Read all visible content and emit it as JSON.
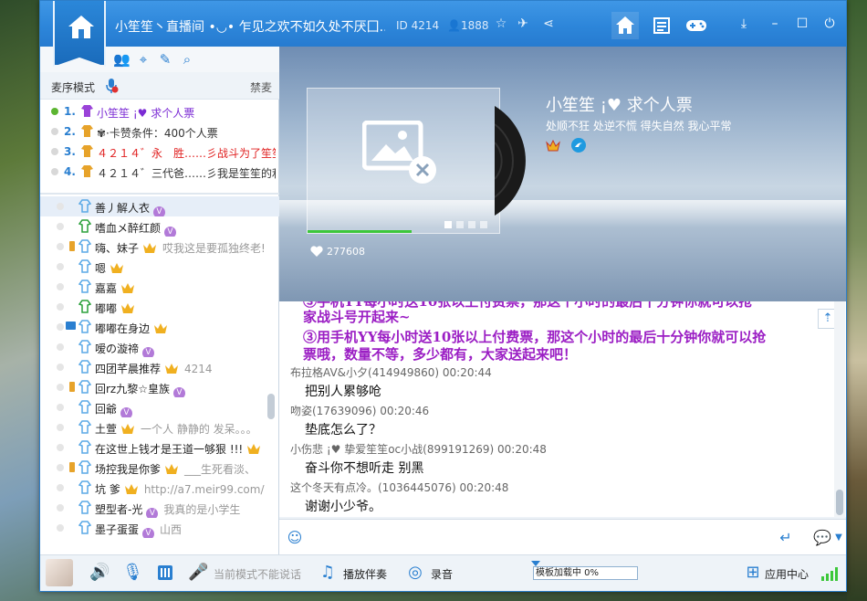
{
  "window": {
    "title": "小笙笙丶直播间 •◡• 乍见之欢不如久处不厌囗...",
    "id_label": "ID 4214",
    "user_count": "1888"
  },
  "left": {
    "mode_label": "麦序模式",
    "ban_label": "禁麦",
    "queue": [
      {
        "num": "1.",
        "text": "小笙笙 ¡♥ 求个人票",
        "color": "purple",
        "active": true
      },
      {
        "num": "2.",
        "text": "✾·卡赞条件：400个人票",
        "color": "dark",
        "active": false
      },
      {
        "num": "3.",
        "text": "４２１４゛永　胜……彡战斗为了笙笙々",
        "color": "red",
        "active": false
      },
      {
        "num": "4.",
        "text": "４２１４゛三代爸……彡我是笙笙的利刃",
        "color": "dark",
        "active": false
      }
    ],
    "members": [
      {
        "name": "善丿解人衣",
        "extra": "",
        "device": "",
        "badge": "v",
        "sel": true
      },
      {
        "name": "嗜血メ醉红颜",
        "extra": "",
        "device": "",
        "badge": "v",
        "sel": false
      },
      {
        "name": "嗨、妹子",
        "extra": "哎我这是要孤独终老!",
        "device": "phone",
        "badge": "crown",
        "sel": false
      },
      {
        "name": "嗯",
        "extra": "",
        "device": "",
        "badge": "crown",
        "sel": false
      },
      {
        "name": "嘉嘉",
        "extra": "",
        "device": "",
        "badge": "crown",
        "sel": false
      },
      {
        "name": "嘟嘟",
        "extra": "",
        "device": "",
        "badge": "crown",
        "sel": false
      },
      {
        "name": "嘟嘟在身边",
        "extra": "",
        "device": "pc",
        "badge": "crown",
        "sel": false
      },
      {
        "name": "嗳の漩禘",
        "extra": "",
        "device": "",
        "badge": "v",
        "sel": false
      },
      {
        "name": "四团芊晨推荐",
        "extra": "4214",
        "device": "",
        "badge": "crown",
        "sel": false
      },
      {
        "name": "回rz九黎☆皇族",
        "extra": "",
        "device": "phone",
        "badge": "v",
        "sel": false
      },
      {
        "name": "回爺",
        "extra": "",
        "device": "",
        "badge": "v",
        "sel": false
      },
      {
        "name": "土萱",
        "extra": "一个人 静静的 发呆。。。",
        "device": "",
        "badge": "crown",
        "sel": false
      },
      {
        "name": "在这世上钱才是王道一够狠 !!!",
        "extra": "",
        "device": "",
        "badge": "crown",
        "sel": false
      },
      {
        "name": "场控我是你爹",
        "extra": "___生死看淡、",
        "device": "phone",
        "badge": "crown",
        "sel": false
      },
      {
        "name": "坑  爹",
        "extra": "http://a7.meir99.com/",
        "device": "",
        "badge": "crown",
        "sel": false
      },
      {
        "name": "塑型者-光",
        "extra": "我真的是小学生",
        "device": "",
        "badge": "v",
        "sel": false
      },
      {
        "name": "墨子蛋蛋",
        "extra": "山西",
        "device": "",
        "badge": "v",
        "sel": false
      }
    ]
  },
  "stage": {
    "anchor_name": "小笙笙 ¡♥ 求个人票",
    "signature": "处顺不狂 处逆不慌 得失自然 我心平常",
    "likes": "277608"
  },
  "chat": {
    "announcement_1": "③手机YY每小时送10张以上付费票，那这个小时的最后十分钟你就可以抢",
    "announcement_1b": "家战斗号开起来~",
    "announcement_2": "③用手机YY每小时送10张以上付费票，那这个小时的最后十分钟你就可以抢",
    "announcement_2b": "票哦，数量不等，多少都有，大家送起来吧！",
    "messages": [
      {
        "sender": "布拉格AV&小夕(414949860) 00:20:44",
        "text": "把别人累够呛"
      },
      {
        "sender": "吻姿(17639096) 00:20:46",
        "text": "垫底怎么了？"
      },
      {
        "sender": "小伤悲 ¡♥  挚爱笙笙oc小战(899191269) 00:20:48",
        "text": "奋斗你不想听走 别黑"
      },
      {
        "sender": "这个冬天有点冷。(1036445076) 00:20:48",
        "text": "谢谢小少爷。"
      }
    ]
  },
  "bottom": {
    "mode_notice": "当前模式不能说话",
    "accompany_label": "播放伴奏",
    "record_label": "录音",
    "template_progress": "模板加载中 0%",
    "app_center_label": "应用中心"
  },
  "colors": {
    "accent": "#2a7fd0",
    "titlebar": "#2d86da",
    "announcement": "#9b1ec4"
  }
}
